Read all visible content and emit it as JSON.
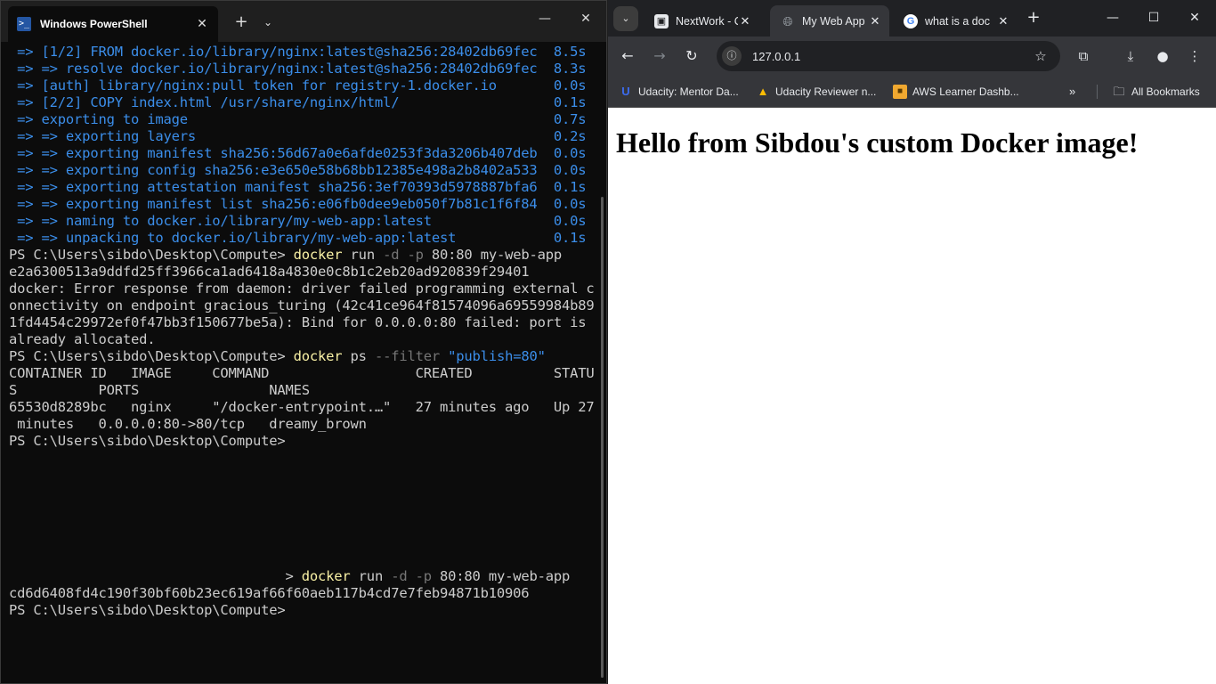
{
  "powershell": {
    "tab_title": "Windows PowerShell",
    "tab_close": "✕",
    "new_tab": "+",
    "dropdown": "⌄",
    "minimize": "—",
    "maximize": "☐",
    "close": "✕",
    "lines": [
      [
        {
          "t": " => [1/2] FROM docker.io/library/nginx:latest@sha256:28402db69fec  8.5s",
          "c": "blue"
        }
      ],
      [
        {
          "t": " => => resolve docker.io/library/nginx:latest@sha256:28402db69fec  8.3s",
          "c": "blue"
        }
      ],
      [
        {
          "t": " => [auth] library/nginx:pull token for registry-1.docker.io       0.0s",
          "c": "blue"
        }
      ],
      [
        {
          "t": " => [2/2] COPY index.html /usr/share/nginx/html/                   0.1s",
          "c": "blue"
        }
      ],
      [
        {
          "t": " => exporting to image                                             0.7s",
          "c": "blue"
        }
      ],
      [
        {
          "t": " => => exporting layers                                            0.2s",
          "c": "blue"
        }
      ],
      [
        {
          "t": " => => exporting manifest sha256:56d67a0e6afde0253f3da3206b407deb  0.0s",
          "c": "blue"
        }
      ],
      [
        {
          "t": " => => exporting config sha256:e3e650e58b68bb12385e498a2b8402a533  0.0s",
          "c": "blue"
        }
      ],
      [
        {
          "t": " => => exporting attestation manifest sha256:3ef70393d5978887bfa6  0.1s",
          "c": "blue"
        }
      ],
      [
        {
          "t": " => => exporting manifest list sha256:e06fb0dee9eb050f7b81c1f6f84  0.0s",
          "c": "blue"
        }
      ],
      [
        {
          "t": " => => naming to docker.io/library/my-web-app:latest               0.0s",
          "c": "blue"
        }
      ],
      [
        {
          "t": " => => unpacking to docker.io/library/my-web-app:latest            0.1s",
          "c": "blue"
        }
      ],
      [
        {
          "t": "PS C:\\Users\\sibdo\\Desktop\\Compute> ",
          "c": ""
        },
        {
          "t": "docker",
          "c": "cmd"
        },
        {
          "t": " run ",
          "c": ""
        },
        {
          "t": "-d -p",
          "c": "param"
        },
        {
          "t": " 80:80 my-web-app",
          "c": ""
        }
      ],
      [
        {
          "t": "e2a6300513a9ddfd25ff3966ca1ad6418a4830e0c8b1c2eb20ad920839f29401",
          "c": ""
        }
      ],
      [
        {
          "t": "docker: Error response from daemon: driver failed programming external c",
          "c": ""
        }
      ],
      [
        {
          "t": "onnectivity on endpoint gracious_turing (42c41ce964f81574096a69559984b89",
          "c": ""
        }
      ],
      [
        {
          "t": "1fd4454c29972ef0f47bb3f150677be5a): Bind for 0.0.0.0:80 failed: port is",
          "c": ""
        }
      ],
      [
        {
          "t": "already allocated.",
          "c": ""
        }
      ],
      [
        {
          "t": "PS C:\\Users\\sibdo\\Desktop\\Compute> ",
          "c": ""
        },
        {
          "t": "docker",
          "c": "cmd"
        },
        {
          "t": " ps ",
          "c": ""
        },
        {
          "t": "--filter",
          "c": "param"
        },
        {
          "t": " ",
          "c": ""
        },
        {
          "t": "\"publish=80\"",
          "c": "str"
        }
      ],
      [
        {
          "t": "CONTAINER ID   IMAGE     COMMAND                  CREATED          STATU",
          "c": ""
        }
      ],
      [
        {
          "t": "S          PORTS                NAMES",
          "c": ""
        }
      ],
      [
        {
          "t": "65530d8289bc   nginx     \"/docker-entrypoint.…\"   27 minutes ago   Up 27",
          "c": ""
        }
      ],
      [
        {
          "t": " minutes   0.0.0.0:80->80/tcp   dreamy_brown",
          "c": ""
        }
      ],
      [
        {
          "t": "PS C:\\Users\\sibdo\\Desktop\\Compute>",
          "c": ""
        }
      ],
      [
        {
          "t": "",
          "c": ""
        }
      ],
      [
        {
          "t": "",
          "c": ""
        }
      ],
      [
        {
          "t": "",
          "c": ""
        }
      ],
      [
        {
          "t": "",
          "c": ""
        }
      ],
      [
        {
          "t": "",
          "c": ""
        }
      ],
      [
        {
          "t": "",
          "c": ""
        }
      ],
      [
        {
          "t": "",
          "c": ""
        }
      ],
      [
        {
          "t": "                                  > ",
          "c": ""
        },
        {
          "t": "docker",
          "c": "cmd"
        },
        {
          "t": " run ",
          "c": ""
        },
        {
          "t": "-d -p",
          "c": "param"
        },
        {
          "t": " 80:80 my-web-app",
          "c": ""
        }
      ],
      [
        {
          "t": "cd6d6408fd4c190f30bf60b23ec619af66f60aeb117b4cd7e7feb94871b10906",
          "c": ""
        }
      ],
      [
        {
          "t": "PS C:\\Users\\sibdo\\Desktop\\Compute>",
          "c": ""
        }
      ]
    ]
  },
  "chrome": {
    "tab_search": "⌄",
    "tabs": [
      {
        "title": "NextWork - C",
        "icon": "nextwork-icon",
        "active": false
      },
      {
        "title": "My Web App",
        "icon": "globe-icon",
        "active": true
      },
      {
        "title": "what is a doc",
        "icon": "google-icon",
        "active": false
      }
    ],
    "tab_close": "✕",
    "new_tab": "+",
    "minimize": "—",
    "maximize": "☐",
    "close": "✕",
    "back": "←",
    "forward": "→",
    "reload": "↻",
    "site_info": "ⓘ",
    "url": "127.0.0.1",
    "star": "☆",
    "bookmarks": [
      {
        "label": "Udacity: Mentor Da...",
        "icon": "udacity-icon"
      },
      {
        "label": "Udacity Reviewer n...",
        "icon": "drive-icon"
      },
      {
        "label": "AWS Learner Dashb...",
        "icon": "aws-icon"
      }
    ],
    "more_bookmarks": "»",
    "all_bookmarks": "All Bookmarks",
    "page_heading": "Hello from Sibdou's custom Docker image!"
  }
}
